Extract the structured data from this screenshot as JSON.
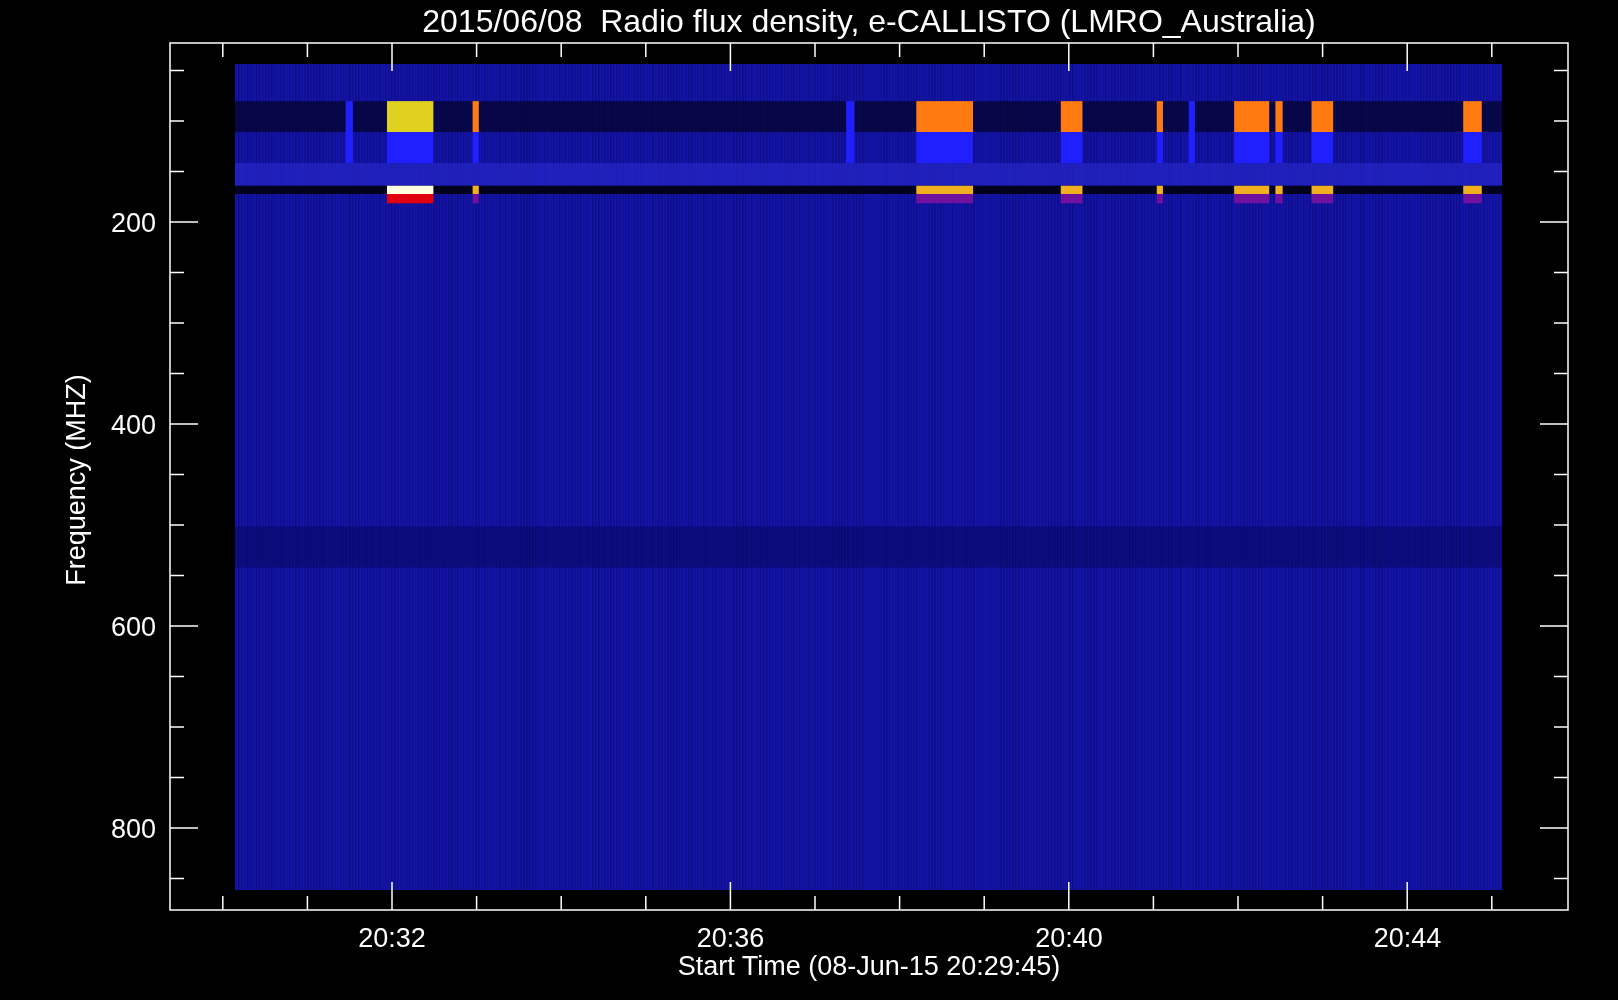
{
  "title": "2015/06/08  Radio flux density, e-CALLISTO (LMRO_Australia)",
  "y_axis": {
    "label": "Frequency (MHZ)",
    "ticks": [
      "200",
      "400",
      "600",
      "800"
    ]
  },
  "x_axis": {
    "label": "Start Time (08-Jun-15 20:29:45)",
    "ticks": [
      "20:32",
      "20:36",
      "20:40",
      "20:44"
    ]
  }
}
